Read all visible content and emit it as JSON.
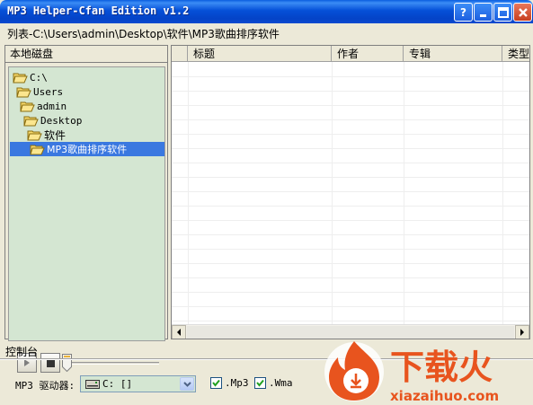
{
  "window": {
    "title": "MP3 Helper-Cfan Edition v1.2",
    "buttons": {
      "help": "?",
      "minimize": "_",
      "maximize": "□",
      "close": "×"
    }
  },
  "path_line": "列表-C:\\Users\\admin\\Desktop\\软件\\MP3歌曲排序软件",
  "left_panel": {
    "title": "本地磁盘",
    "tree": [
      {
        "label": "C:\\",
        "icon": "folder-open-icon"
      },
      {
        "label": "Users",
        "icon": "folder-open-icon"
      },
      {
        "label": "admin",
        "icon": "folder-open-icon"
      },
      {
        "label": "Desktop",
        "icon": "folder-open-icon"
      },
      {
        "label": "软件",
        "icon": "folder-open-icon"
      },
      {
        "label": "MP3歌曲排序软件",
        "icon": "folder-open-icon",
        "selected": true
      }
    ],
    "player": {
      "play_icon": "play-icon",
      "stop_icon": "stop-icon",
      "position": 0
    }
  },
  "list": {
    "columns": [
      "",
      "标题",
      "作者",
      "专辑",
      "类型"
    ],
    "rows": []
  },
  "console": {
    "title": "控制台",
    "drive_label": "MP3 驱动器:",
    "drive_value": "C: []",
    "mp3_label": ".Mp3",
    "mp3_checked": true,
    "wma_label": ".Wma",
    "wma_checked": true
  },
  "watermark": {
    "brand": "下载火",
    "domain": "xiazaihuo.com",
    "color": "#e8541e"
  },
  "colors": {
    "titlebar": "#0550d8",
    "tree_bg": "#d4e6d2",
    "selection": "#3a78e0"
  }
}
